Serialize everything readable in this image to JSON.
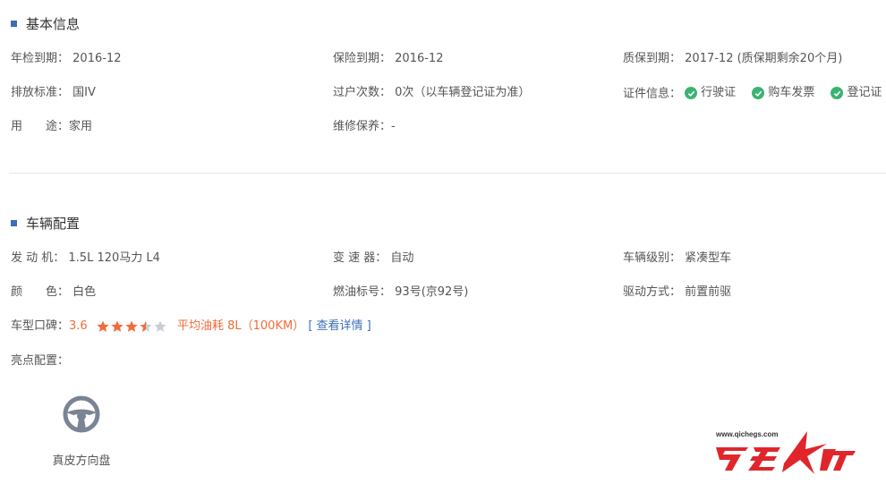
{
  "basic": {
    "title": "基本信息",
    "annual_inspection": {
      "label": "年检到期：",
      "value": "2016-12"
    },
    "insurance": {
      "label": "保险到期：",
      "value": "2016-12"
    },
    "warranty": {
      "label": "质保到期：",
      "value": "2017-12 (质保期剩余20个月)"
    },
    "emission": {
      "label": "排放标准：",
      "value": "国IV"
    },
    "transfers": {
      "label": "过户次数：",
      "value": "0次（以车辆登记证为准）"
    },
    "certificates": {
      "label": "证件信息：",
      "items": [
        "行驶证",
        "购车发票",
        "登记证"
      ]
    },
    "usage": {
      "label": "用　　途：",
      "value": "家用"
    },
    "maintenance": {
      "label": "维修保养：",
      "value": "-"
    }
  },
  "config": {
    "title": "车辆配置",
    "engine": {
      "label": "发 动 机：",
      "value": "1.5L 120马力 L4"
    },
    "transmission": {
      "label": "变 速 器：",
      "value": "自动"
    },
    "level": {
      "label": "车辆级别：",
      "value": "紧凑型车"
    },
    "color": {
      "label": "颜　　色：",
      "value": "白色"
    },
    "fuel": {
      "label": "燃油标号：",
      "value": "93号(京92号)"
    },
    "drive": {
      "label": "驱动方式：",
      "value": "前置前驱"
    },
    "rating": {
      "label": "车型口碑：",
      "score": "3.6",
      "stars_filled": 3.5,
      "stars_total": 5,
      "fuel_text": "平均油耗 8L（100KM）",
      "details_link": "[ 查看详情 ]"
    },
    "highlights": {
      "label": "亮点配置：",
      "items": [
        {
          "name": "真皮方向盘",
          "icon": "steering-wheel-icon"
        }
      ]
    }
  },
  "watermark": {
    "url": "www.qichegs.com",
    "brand": "汽车杠"
  },
  "colors": {
    "accent": "#3a6fb5",
    "orange": "#f26b3a",
    "check": "#3cb371",
    "star_empty": "#c8ccd6",
    "logo_red": "#e0262b"
  }
}
